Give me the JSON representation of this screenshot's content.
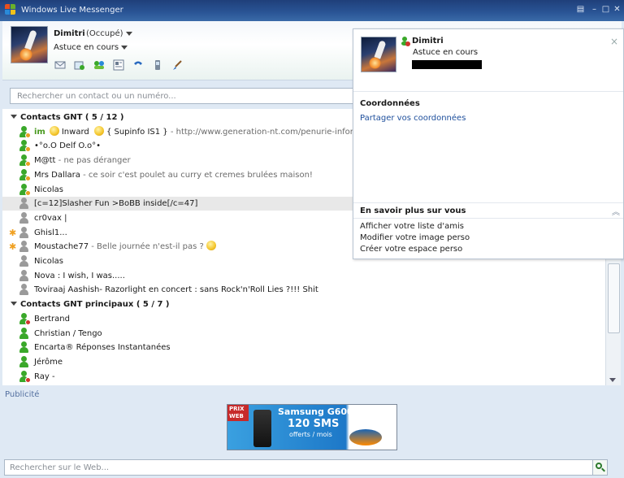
{
  "window": {
    "title": "Windows Live Messenger"
  },
  "profile": {
    "name": "Dimitri",
    "status": "(Occupé)",
    "message": "Astuce en cours"
  },
  "toolbar": [
    "mail-icon",
    "photo-icon",
    "contacts-icon",
    "news-icon",
    "phone-icon",
    "mobile-icon",
    "paint-brush-icon"
  ],
  "search": {
    "placeholder": "Rechercher un contact ou un numéro..."
  },
  "groups": [
    {
      "label": "Contacts GNT ( 5 / 12 )"
    },
    {
      "label": "Contacts GNT principaux ( 5 / 7 )"
    }
  ],
  "contacts": [
    {
      "pre": "im",
      "name": "Inward",
      "extra": "{ Supinfo IS1 }",
      "sub": " - http://www.generation-nt.com/penurie-informaticien-mo",
      "status": "away"
    },
    {
      "name": "•°o.O Delf O.o°•",
      "sub": "",
      "status": "away"
    },
    {
      "name": "M@tt",
      "sub": " - ne pas déranger",
      "status": "away"
    },
    {
      "name": "Mrs Dallara",
      "sub": " - ce soir c'est poulet au curry et cremes brulées maison!",
      "status": "away"
    },
    {
      "name": "Nicolas",
      "sub": "",
      "status": "away"
    },
    {
      "name": "[c=12]Slasher Fun >BoBB inside[/c=47]",
      "sub": "",
      "status": "offline",
      "selected": true
    },
    {
      "name": "cr0vax |",
      "sub": "",
      "status": "offline"
    },
    {
      "name": "Ghisl1...",
      "sub": "",
      "status": "offline",
      "star": true
    },
    {
      "name": "Moustache77",
      "sub": " - Belle journée n'est-il pas ?",
      "status": "offline",
      "star": true,
      "smiley": true
    },
    {
      "name": "Nicolas",
      "sub": "",
      "status": "offline"
    },
    {
      "name": "Nova : I wish, I was.....",
      "sub": "",
      "status": "offline"
    },
    {
      "name": "Toviraaj Aashish- Razorlight en concert : sans Rock'n'Roll Lies ?!!! Shit",
      "sub": "",
      "status": "offline"
    },
    {
      "name": "Bertrand",
      "sub": "",
      "status": "busy"
    },
    {
      "name": "Christian / Tengo",
      "sub": "",
      "status": "online"
    },
    {
      "name": "Encarta® Réponses Instantanées",
      "sub": "",
      "status": "online"
    },
    {
      "name": "Jérôme",
      "sub": "",
      "status": "online"
    },
    {
      "name": "Ray -",
      "sub": "",
      "status": "busy"
    }
  ],
  "ad": {
    "label": "Publicité",
    "corner": "PRIX WEB",
    "brand": "Samsung G600",
    "headline": "120 SMS",
    "offer": "offerts / mois"
  },
  "websearch": {
    "placeholder": "Rechercher sur le Web..."
  },
  "card": {
    "name": "Dimitri",
    "message": "Astuce en cours",
    "section1_title": "Coordonnées",
    "section1_link": "Partager vos coordonnées",
    "section2_title": "En savoir plus sur vous",
    "items": [
      "Afficher votre liste d'amis",
      "Modifier votre image perso",
      "Créer votre espace perso"
    ]
  },
  "colors": {
    "online": "#3aa82a",
    "away": "#e6a020",
    "busy": "#d0342c",
    "offline": "#9a9a9a"
  }
}
